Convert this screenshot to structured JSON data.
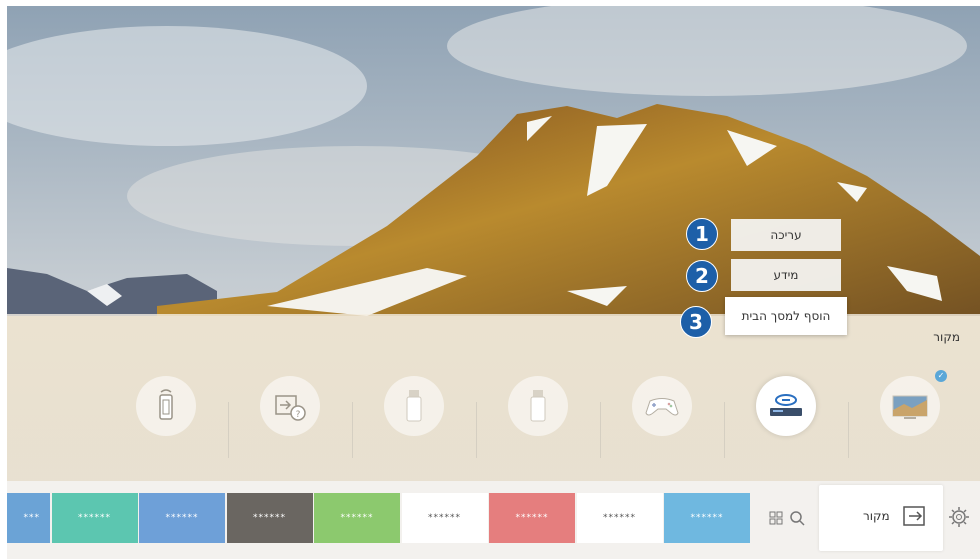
{
  "section_title": "מקור",
  "context_menu": {
    "items": [
      {
        "number": "1",
        "label": "עריכה"
      },
      {
        "number": "2",
        "label": "מידע"
      },
      {
        "number": "3",
        "label": "הוסף למסך הבית"
      }
    ]
  },
  "sources": [
    {
      "icon": "remote-icon"
    },
    {
      "icon": "source-help-icon"
    },
    {
      "icon": "usb-icon"
    },
    {
      "icon": "usb-icon"
    },
    {
      "icon": "gamepad-icon"
    },
    {
      "icon": "bluray-player-icon",
      "selected": true
    },
    {
      "icon": "tv-icon",
      "checked": true
    }
  ],
  "bottom_bar": {
    "source_label": "מקור",
    "apps": [
      {
        "label": "***",
        "color": "#6ba3d6"
      },
      {
        "label": "******",
        "color": "#5cc6b0"
      },
      {
        "label": "******",
        "color": "#6ea0d8"
      },
      {
        "label": "******",
        "color": "#6a6661"
      },
      {
        "label": "******",
        "color": "#8cc96e"
      },
      {
        "label": "******",
        "color": "#ffffff"
      },
      {
        "label": "******",
        "color": "#e57e7e"
      },
      {
        "label": "******",
        "color": "#ffffff"
      },
      {
        "label": "******",
        "color": "#6fb8e0"
      }
    ]
  },
  "colors": {
    "badge": "#1d5fa8",
    "accent_check": "#5aa7d8"
  }
}
